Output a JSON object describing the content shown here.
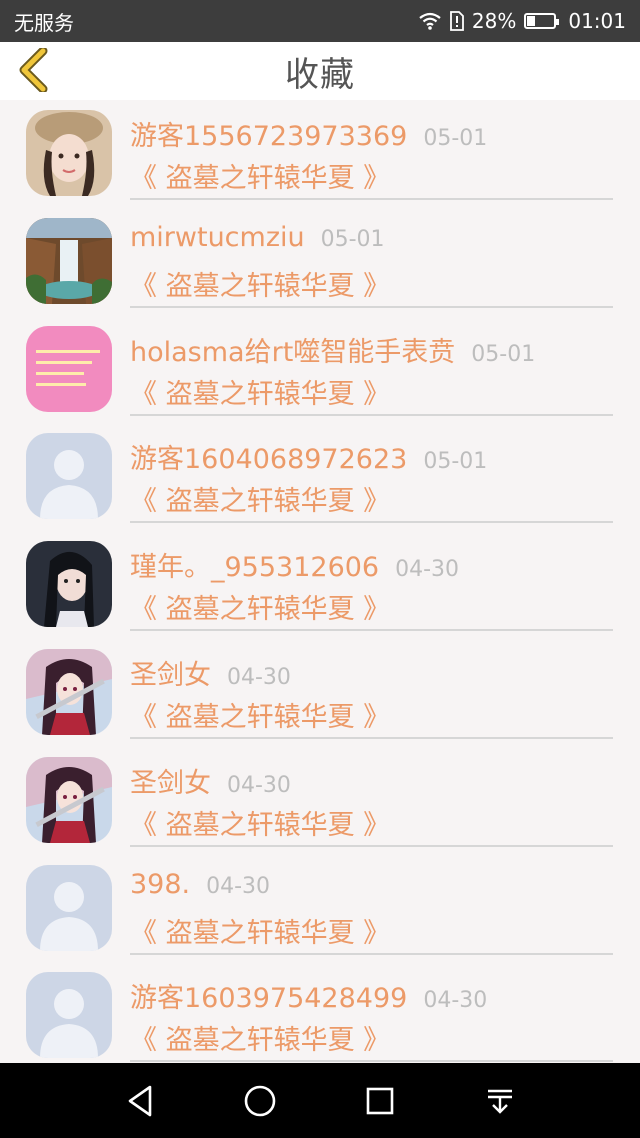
{
  "status_bar": {
    "carrier": "无服务",
    "battery_percent": "28%",
    "battery_level": 0.28,
    "time": "01:01"
  },
  "header": {
    "title": "收藏",
    "back_icon": "chevron-left-icon"
  },
  "colors": {
    "accent": "#ec9a68",
    "back_icon": "#f0c63a",
    "date": "#bdbdbd",
    "status_bar": "#3d3d3d",
    "system_nav": "#000000"
  },
  "items": [
    {
      "username": "游客1556723973369",
      "date": "05-01",
      "book": "《 盗墓之轩辕华夏 》",
      "avatar": "girl-photo"
    },
    {
      "username": "mirwtucmziu",
      "date": "05-01",
      "book": "《 盗墓之轩辕华夏 》",
      "avatar": "waterfall"
    },
    {
      "username": "holasma给rt噬智能手表贲",
      "date": "05-01",
      "book": "《 盗墓之轩辕华夏 》",
      "avatar": "pink-text"
    },
    {
      "username": "游客1604068972623",
      "date": "05-01",
      "book": "《 盗墓之轩辕华夏 》",
      "avatar": "default-user"
    },
    {
      "username": "瑾年。_955312606",
      "date": "04-30",
      "book": "《 盗墓之轩辕华夏 》",
      "avatar": "dark-hair-girl"
    },
    {
      "username": "圣剑女",
      "date": "04-30",
      "book": "《 盗墓之轩辕华夏 》",
      "avatar": "anime-girl"
    },
    {
      "username": "圣剑女",
      "date": "04-30",
      "book": "《 盗墓之轩辕华夏 》",
      "avatar": "anime-girl"
    },
    {
      "username": "398.",
      "date": "04-30",
      "book": "《 盗墓之轩辕华夏 》",
      "avatar": "default-user"
    },
    {
      "username": "游客1603975428499",
      "date": "04-30",
      "book": "《 盗墓之轩辕华夏 》",
      "avatar": "default-user"
    }
  ],
  "system_nav": {
    "buttons": [
      "back-triangle-icon",
      "home-circle-icon",
      "recents-square-icon",
      "notification-pull-down-icon"
    ]
  }
}
